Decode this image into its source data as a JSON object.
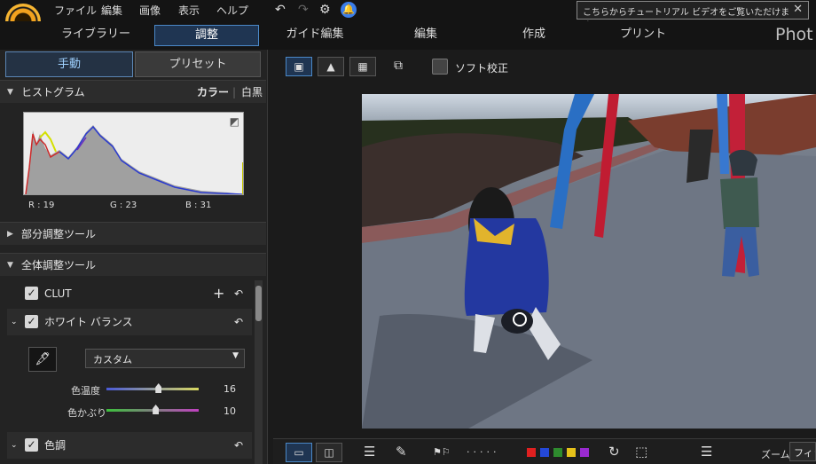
{
  "menu": [
    "ファイル",
    "編集",
    "画像",
    "表示",
    "ヘルプ"
  ],
  "tutorial": {
    "text": "こちらからチュートリアル ビデオをご覧いただけます。",
    "close": "✕"
  },
  "modes": [
    "ライブラリー",
    "調整",
    "ガイド編集",
    "編集",
    "作成",
    "プリント"
  ],
  "brand": "Phot",
  "panel_tabs": {
    "manual": "手動",
    "preset": "プリセット"
  },
  "histogram": {
    "title": "ヒストグラム",
    "color": "カラー",
    "mono": "白黒",
    "r": "R : 19",
    "g": "G : 23",
    "b": "B : 31"
  },
  "sections": {
    "local": "部分調整ツール",
    "global": "全体調整ツール"
  },
  "tools": {
    "clut": "CLUT",
    "wb": "ホワイト バランス",
    "tone": "色調",
    "plus": "+",
    "undo": "↶"
  },
  "wb": {
    "preset": "カスタム",
    "temp_label": "色温度",
    "temp_value": "16",
    "tint_label": "色かぶり",
    "tint_value": "10",
    "temp_level": 0.56,
    "tint_level": 0.53
  },
  "view": {
    "soft_proof": "ソフト校正"
  },
  "zoom": {
    "label": "ズーム:",
    "value": "フィット"
  },
  "colors": {
    "accent": "#4a88c7",
    "labels": [
      "#e02020",
      "#2448d8",
      "#2e8b2e",
      "#e6c21a",
      "#9a2ad0"
    ]
  },
  "icons": {
    "undo": "undo-icon",
    "redo": "redo-icon",
    "settings": "gear-icon",
    "notify": "bell-icon"
  }
}
